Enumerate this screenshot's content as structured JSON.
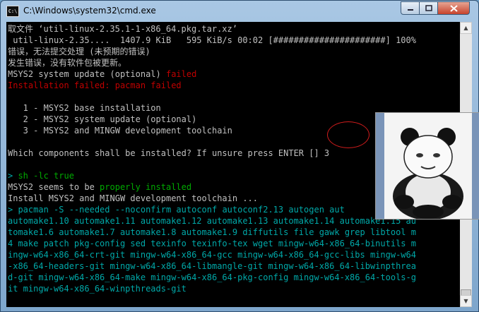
{
  "window": {
    "title": "C:\\Windows\\system32\\cmd.exe",
    "icon_label": "C:\\",
    "icon": "cmd-icon",
    "controls": {
      "minimize": "minimize-icon",
      "maximize": "maximize-icon",
      "close": "close-icon"
    }
  },
  "console": {
    "lines": [
      [
        {
          "t": "取文件 ‘util-linux-2.35.1-1-x86_64.pkg.tar.xz’",
          "c": ""
        }
      ],
      [
        {
          "t": " util-linux-2.35....  1407.9 KiB   595 KiB/s 00:02 [######################] 100%",
          "c": ""
        }
      ],
      [
        {
          "t": "错误，无法提交处理 (未预期的错误)",
          "c": ""
        }
      ],
      [
        {
          "t": "发生错误，没有软件包被更新。",
          "c": ""
        }
      ],
      [
        {
          "t": "MSYS2 system update (optional) ",
          "c": ""
        },
        {
          "t": "failed",
          "c": "red"
        }
      ],
      [
        {
          "t": "Installation failed: pacman failed",
          "c": "red"
        }
      ],
      [
        {
          "t": "",
          "c": ""
        }
      ],
      [
        {
          "t": "   1 - MSYS2 base installation",
          "c": ""
        }
      ],
      [
        {
          "t": "   2 - MSYS2 system update (optional)",
          "c": ""
        }
      ],
      [
        {
          "t": "   3 - MSYS2 and MINGW development toolchain",
          "c": ""
        }
      ],
      [
        {
          "t": "",
          "c": ""
        }
      ],
      [
        {
          "t": "Which components shall be installed? If unsure press ENTER [] 3",
          "c": ""
        }
      ],
      [
        {
          "t": "",
          "c": ""
        }
      ],
      [
        {
          "t": "> ",
          "c": "cyan"
        },
        {
          "t": "sh -lc true",
          "c": "green"
        }
      ],
      [
        {
          "t": "MSYS2 seems to be ",
          "c": ""
        },
        {
          "t": "properly installed",
          "c": "green"
        }
      ],
      [
        {
          "t": "Install MSYS2 and MINGW development toolchain ...",
          "c": ""
        }
      ],
      [
        {
          "t": "> ",
          "c": "cyan"
        },
        {
          "t": "pacman -S --needed --noconfirm autoconf autoconf2.13 autogen aut",
          "c": "cyan"
        }
      ],
      [
        {
          "t": "automake1.10 automake1.11 automake1.12 automake1.13 automake1.14 automake1.15 au",
          "c": "cyan"
        }
      ],
      [
        {
          "t": "tomake1.6 automake1.7 automake1.8 automake1.9 diffutils file gawk grep libtool m",
          "c": "cyan"
        }
      ],
      [
        {
          "t": "4 make patch pkg-config sed texinfo texinfo-tex wget mingw-w64-x86_64-binutils m",
          "c": "cyan"
        }
      ],
      [
        {
          "t": "ingw-w64-x86_64-crt-git mingw-w64-x86_64-gcc mingw-w64-x86_64-gcc-libs mingw-w64",
          "c": "cyan"
        }
      ],
      [
        {
          "t": "-x86_64-headers-git mingw-w64-x86_64-libmangle-git mingw-w64-x86_64-libwinpthrea",
          "c": "cyan"
        }
      ],
      [
        {
          "t": "d-git mingw-w64-x86_64-make mingw-w64-x86_64-pkg-config mingw-w64-x86_64-tools-g",
          "c": "cyan"
        }
      ],
      [
        {
          "t": "it mingw-w64-x86_64-winpthreads-git",
          "c": "cyan"
        }
      ]
    ]
  },
  "colors": {
    "console_bg": "#000000",
    "text": "#c0c0c0",
    "error": "#c00000",
    "success": "#00aa00",
    "command": "#00a8a8",
    "annotation": "#d01c1c"
  },
  "scrollbar": {
    "up_icon": "scroll-up-arrow-icon",
    "down_icon": "scroll-down-arrow-icon"
  },
  "overlay": {
    "image": "panda-meme-sticker"
  }
}
